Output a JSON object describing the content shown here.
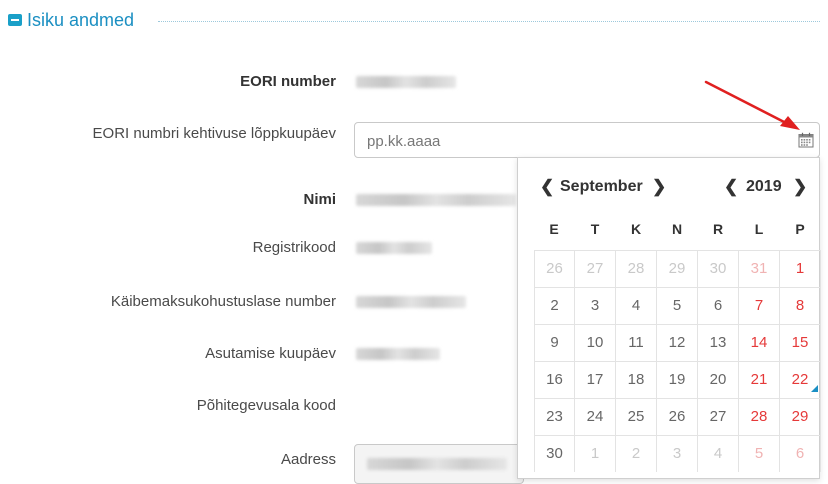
{
  "section": {
    "title": "Isiku andmed"
  },
  "fields": {
    "eori_number": "EORI number",
    "eori_validity": "EORI numbri kehtivuse lõppkuupäev",
    "name": "Nimi",
    "registry_code": "Registrikood",
    "vat_number": "Käibemaksukohustuslase number",
    "founding_date": "Asutamise kuupäev",
    "main_activity_code": "Põhitegevusala kood",
    "address": "Aadress"
  },
  "date_input": {
    "placeholder": "pp.kk.aaaa",
    "value": ""
  },
  "calendar": {
    "month": "September",
    "year": "2019",
    "prev_month": "❮",
    "next_month": "❯",
    "prev_year": "❮",
    "next_year": "❯",
    "weekdays": [
      "E",
      "T",
      "K",
      "N",
      "R",
      "L",
      "P"
    ],
    "weeks": [
      [
        {
          "d": "26",
          "m": true
        },
        {
          "d": "27",
          "m": true
        },
        {
          "d": "28",
          "m": true
        },
        {
          "d": "29",
          "m": true
        },
        {
          "d": "30",
          "m": true
        },
        {
          "d": "31",
          "m": true
        },
        {
          "d": "1",
          "m": false
        }
      ],
      [
        {
          "d": "2",
          "m": false
        },
        {
          "d": "3",
          "m": false
        },
        {
          "d": "4",
          "m": false
        },
        {
          "d": "5",
          "m": false
        },
        {
          "d": "6",
          "m": false
        },
        {
          "d": "7",
          "m": false
        },
        {
          "d": "8",
          "m": false
        }
      ],
      [
        {
          "d": "9",
          "m": false
        },
        {
          "d": "10",
          "m": false
        },
        {
          "d": "11",
          "m": false
        },
        {
          "d": "12",
          "m": false
        },
        {
          "d": "13",
          "m": false
        },
        {
          "d": "14",
          "m": false
        },
        {
          "d": "15",
          "m": false
        }
      ],
      [
        {
          "d": "16",
          "m": false
        },
        {
          "d": "17",
          "m": false
        },
        {
          "d": "18",
          "m": false
        },
        {
          "d": "19",
          "m": false
        },
        {
          "d": "20",
          "m": false
        },
        {
          "d": "21",
          "m": false
        },
        {
          "d": "22",
          "m": false,
          "today": true
        }
      ],
      [
        {
          "d": "23",
          "m": false
        },
        {
          "d": "24",
          "m": false
        },
        {
          "d": "25",
          "m": false
        },
        {
          "d": "26",
          "m": false
        },
        {
          "d": "27",
          "m": false
        },
        {
          "d": "28",
          "m": false
        },
        {
          "d": "29",
          "m": false
        }
      ],
      [
        {
          "d": "30",
          "m": false
        },
        {
          "d": "1",
          "m": true
        },
        {
          "d": "2",
          "m": true
        },
        {
          "d": "3",
          "m": true
        },
        {
          "d": "4",
          "m": true
        },
        {
          "d": "5",
          "m": true
        },
        {
          "d": "6",
          "m": true
        }
      ]
    ]
  },
  "colors": {
    "accent": "#1b8fc2",
    "weekend": "#e53939",
    "arrow": "#e02020"
  },
  "icons": {
    "calendar": "calendar-icon",
    "collapse": "minus-square-icon",
    "annotation": "red-arrow-icon"
  }
}
